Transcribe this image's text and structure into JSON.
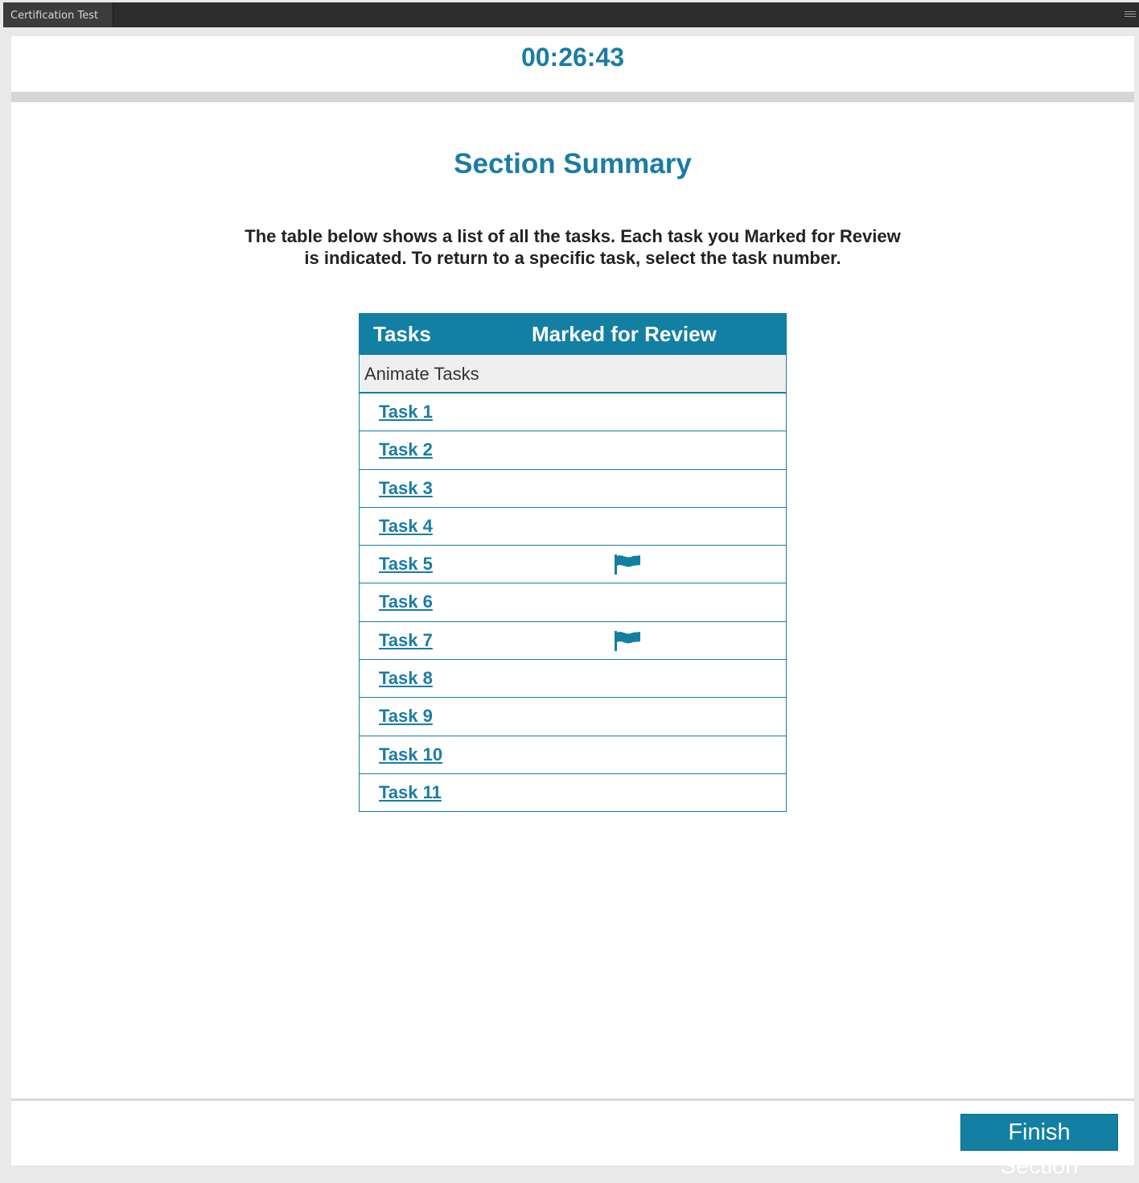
{
  "window": {
    "tab_title": "Certification Test",
    "menu_icon": "hamburger-icon"
  },
  "timer": "00:26:43",
  "section": {
    "title": "Section Summary",
    "instructions": "The table below shows a list of all the tasks. Each task you Marked for Review\nis indicated. To return to a specific task, select the task number."
  },
  "table": {
    "headers": [
      "Tasks",
      "Marked for Review"
    ],
    "group_label": "Animate Tasks",
    "rows": [
      {
        "label": "Task 1",
        "marked": false
      },
      {
        "label": "Task 2",
        "marked": false
      },
      {
        "label": "Task 3",
        "marked": false
      },
      {
        "label": "Task 4",
        "marked": false
      },
      {
        "label": "Task 5",
        "marked": true
      },
      {
        "label": "Task 6",
        "marked": false
      },
      {
        "label": "Task 7",
        "marked": true
      },
      {
        "label": "Task 8",
        "marked": false
      },
      {
        "label": "Task 9",
        "marked": false
      },
      {
        "label": "Task 10",
        "marked": false
      },
      {
        "label": "Task 11",
        "marked": false
      }
    ],
    "flag_icon": "flag-icon"
  },
  "footer": {
    "finish_label": "Finish Section"
  },
  "colors": {
    "accent": "#127fa3",
    "title_text": "#1a7ca6"
  }
}
